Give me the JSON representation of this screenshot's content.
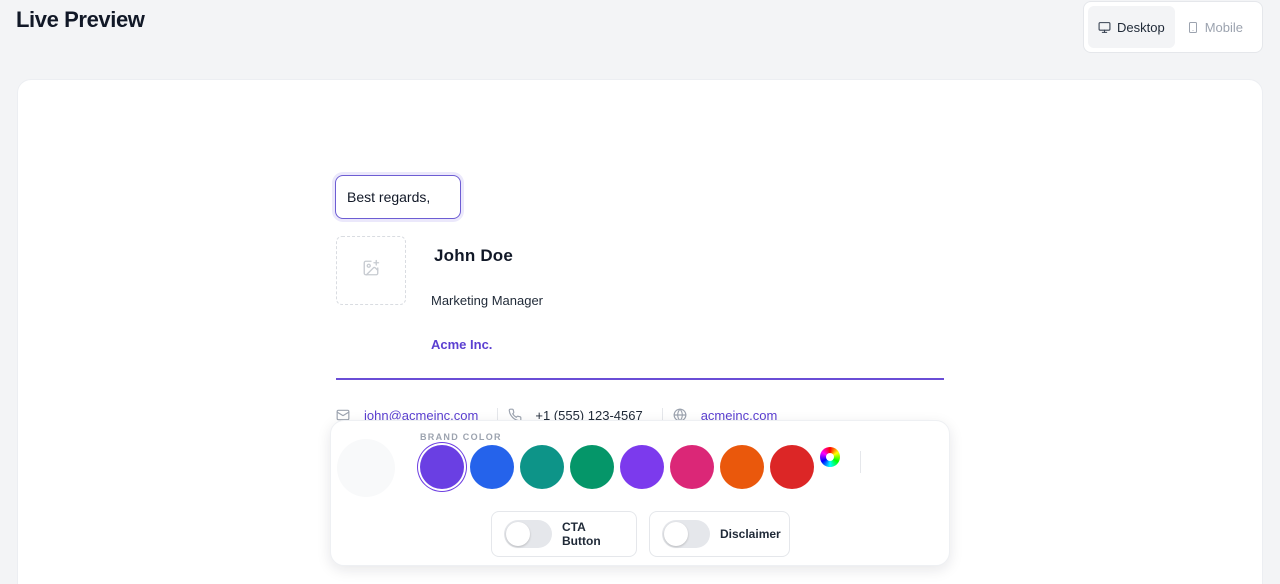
{
  "header": {
    "title": "Live Preview"
  },
  "view_toggle": {
    "options": [
      {
        "label": "Desktop",
        "icon": "monitor-icon",
        "active": true
      },
      {
        "label": "Mobile",
        "icon": "smartphone-icon",
        "active": false
      }
    ]
  },
  "signature": {
    "signoff": "Best regards,",
    "photo_icon": "image-plus-icon",
    "name": "John Doe",
    "job_title": "Marketing Manager",
    "company": "Acme Inc.",
    "divider_color": "#6a4dd6",
    "contacts": {
      "email": {
        "icon": "mail-icon",
        "value": "john@acmeinc.com"
      },
      "phone": {
        "icon": "phone-icon",
        "value": "+1 (555) 123-4567"
      },
      "website": {
        "icon": "globe-icon",
        "value": "acmeinc.com"
      }
    }
  },
  "toolbar": {
    "brand_color_label": "BRAND COLOR",
    "swatches": [
      {
        "name": "indigo",
        "color": "#6a3fe3",
        "selected": true
      },
      {
        "name": "blue",
        "color": "#2563eb",
        "selected": false
      },
      {
        "name": "teal",
        "color": "#0d9488",
        "selected": false
      },
      {
        "name": "green",
        "color": "#059669",
        "selected": false
      },
      {
        "name": "violet",
        "color": "#7c3aed",
        "selected": false
      },
      {
        "name": "pink",
        "color": "#db2777",
        "selected": false
      },
      {
        "name": "orange",
        "color": "#ea580c",
        "selected": false
      },
      {
        "name": "red",
        "color": "#dc2626",
        "selected": false
      }
    ],
    "custom_color_icon": "color-wheel-icon",
    "toggles": {
      "cta": {
        "label": "CTA Button",
        "on": false
      },
      "disclaimer": {
        "label": "Disclaimer",
        "on": false
      }
    }
  }
}
